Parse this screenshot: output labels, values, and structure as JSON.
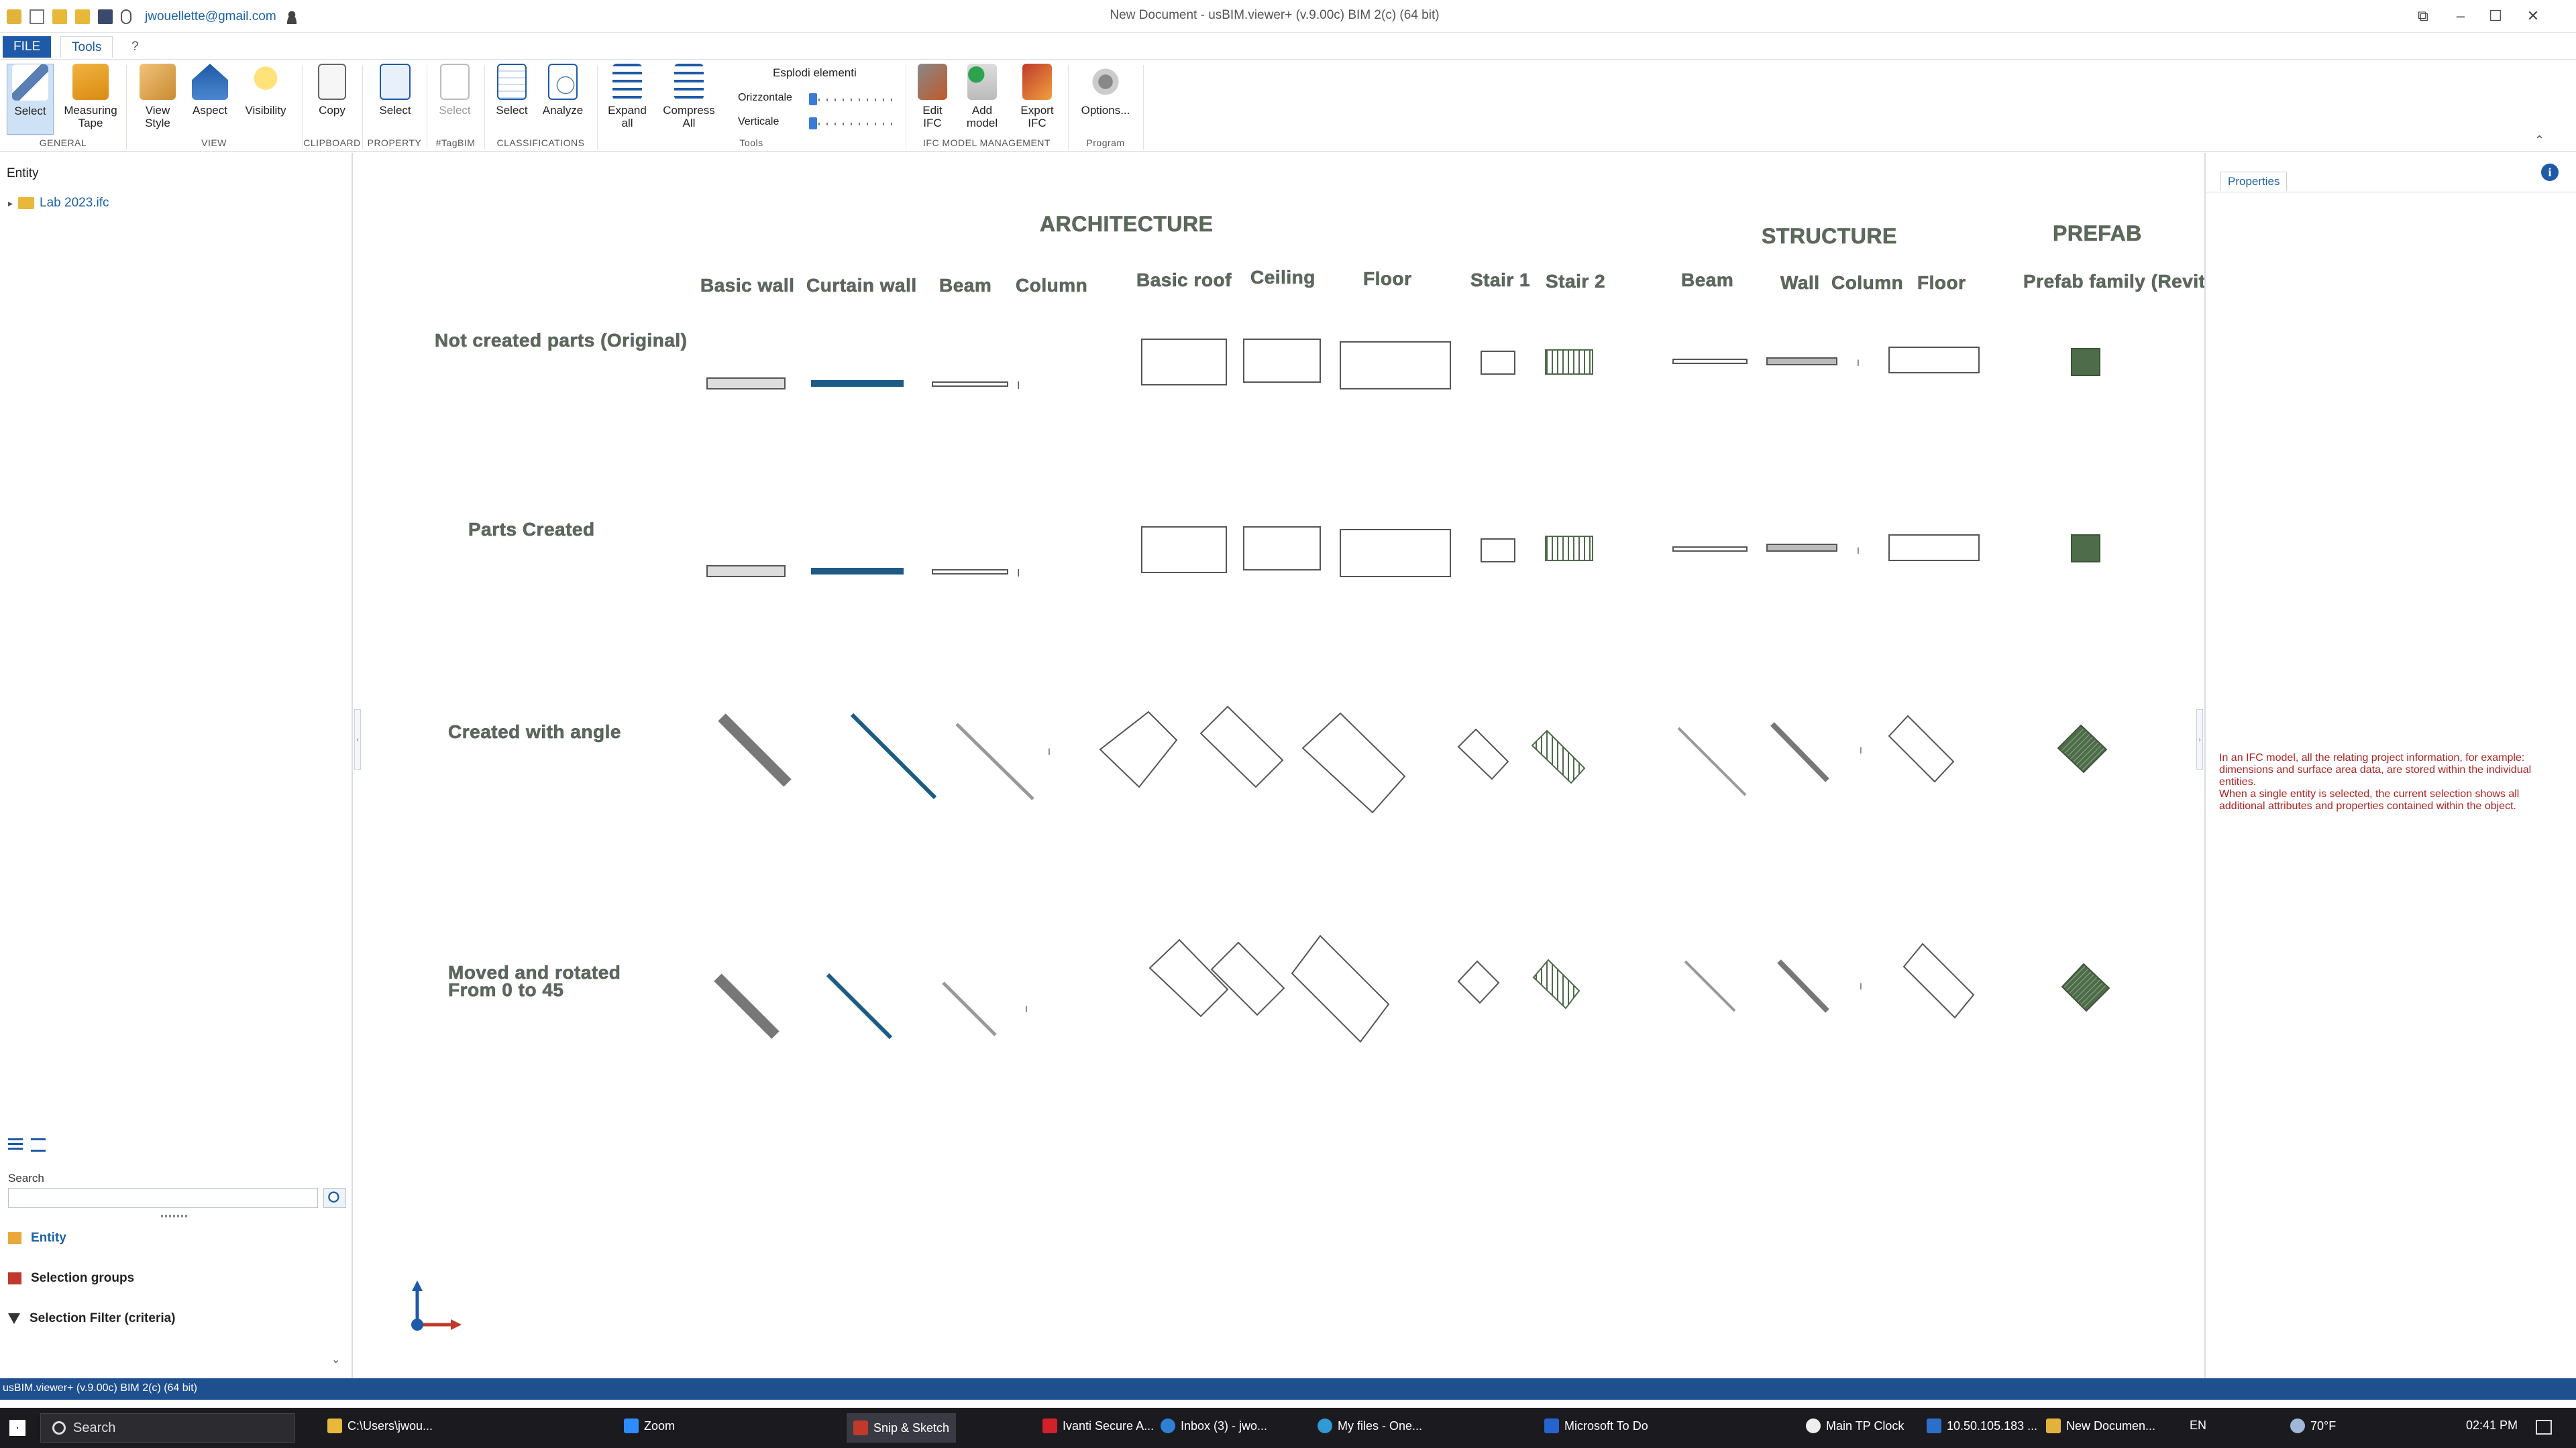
{
  "titlebar": {
    "user_email": "jwouellette@gmail.com",
    "title": "New Document - usBIM.viewer+ (v.9.00c)  BIM 2(c) (64 bit)"
  },
  "tabs": {
    "file": "FILE",
    "tools": "Tools",
    "help": "?"
  },
  "ribbon": {
    "select": "Select",
    "measuring_tape": "Measuring\nTape",
    "view_style": "View\nStyle",
    "aspect": "Aspect",
    "visibility": "Visibility",
    "copy": "Copy",
    "property_select": "Select",
    "tagbim_select": "Select",
    "class_select": "Select",
    "analyze": "Analyze",
    "expand_all": "Expand\nall",
    "compress_all": "Compress\nAll",
    "explode_title": "Esplodi elementi",
    "horizontal": "Orizzontale",
    "vertical": "Verticale",
    "edit_ifc": "Edit\nIFC",
    "add_model": "Add\nmodel",
    "export_ifc": "Export\nIFC",
    "options": "Options...",
    "groups": {
      "general": "GENERAL",
      "view": "VIEW",
      "clipboard": "CLIPBOARD",
      "property": "PROPERTY",
      "tagbim": "#TagBIM",
      "classifications": "CLASSIFICATIONS",
      "tools": "Tools",
      "ifc": "IFC MODEL MANAGEMENT",
      "program": "Program"
    }
  },
  "left_panel": {
    "header": "Entity",
    "tree_root": "Lab 2023.ifc",
    "search_label": "Search",
    "search_placeholder": "",
    "nav": {
      "entity": "Entity",
      "selection_groups": "Selection groups",
      "selection_filter": "Selection Filter (criteria)"
    }
  },
  "viewport": {
    "headers": {
      "architecture": "ARCHITECTURE",
      "structure": "STRUCTURE",
      "prefab": "PREFAB"
    },
    "columns": {
      "basic_wall": "Basic wall",
      "curtain_wall": "Curtain wall",
      "beam": "Beam",
      "column": "Column",
      "basic_roof": "Basic roof",
      "ceiling": "Ceiling",
      "floor": "Floor",
      "stair1": "Stair 1",
      "stair2": "Stair 2",
      "s_beam": "Beam",
      "s_wall": "Wall",
      "s_column": "Column",
      "s_floor": "Floor",
      "prefab_family": "Prefab family (Revit"
    },
    "rows": {
      "r1": "Not created parts (Original)",
      "r2": "Parts Created",
      "r3": "Created with angle",
      "r4a": "Moved and rotated",
      "r4b": "From 0 to 45"
    }
  },
  "right_panel": {
    "tab": "Properties",
    "info_text": "In an IFC model, all the relating project information, for example: dimensions and surface area data, are stored within the individual entities.\nWhen a single entity is selected, the current selection shows all additional attributes and properties contained within the object."
  },
  "statusbar": {
    "text": "usBIM.viewer+ (v.9.00c)  BIM 2(c) (64 bit)"
  },
  "taskbar": {
    "search": "Search",
    "items": [
      "C:\\Users\\jwou...",
      "Zoom",
      "Snip & Sketch",
      "Ivanti Secure A...",
      "Inbox (3) - jwo...",
      "My files - One...",
      "Microsoft To Do",
      "Main TP Clock",
      "10.50.105.183 ...",
      "New Documen..."
    ],
    "lang": "EN",
    "weather": "70°F",
    "time": "02:41 PM"
  },
  "colors": {
    "accent": "#1e5aa8",
    "model_green": "#4e6b4a",
    "curtain_blue": "#1d5b86",
    "info_red": "#b02020"
  }
}
